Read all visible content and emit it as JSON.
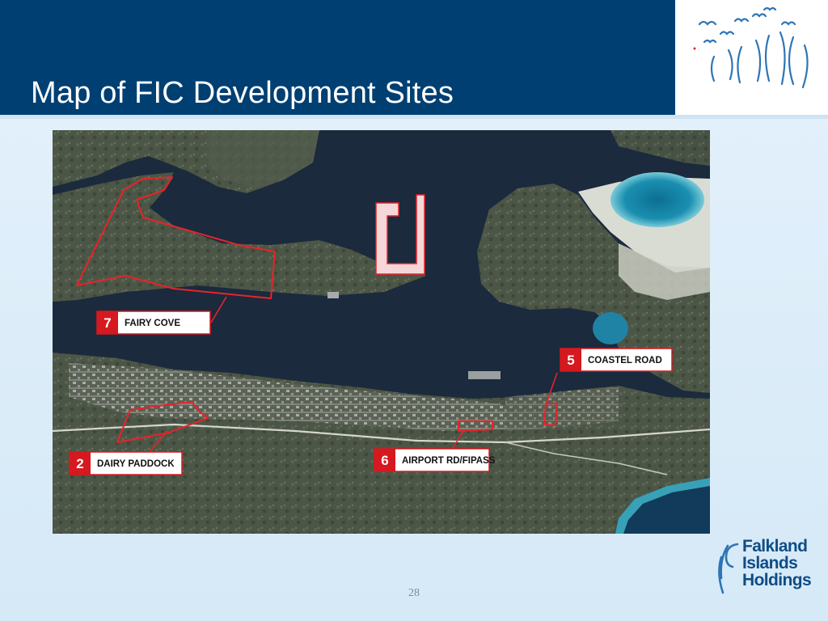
{
  "slide": {
    "title": "Map of FIC Development Sites",
    "page_number": "28"
  },
  "colors": {
    "header_band": "#003f72",
    "slide_background": "#dcedf9",
    "site_outline": "#e8232a",
    "label_number_box": "#d6181f",
    "logo_text": "#0e4d87"
  },
  "map": {
    "type": "aerial-photograph",
    "sites": [
      {
        "number": "7",
        "name": "FAIRY COVE"
      },
      {
        "number": "5",
        "name": "COASTEL ROAD"
      },
      {
        "number": "2",
        "name": "DAIRY PADDOCK"
      },
      {
        "number": "6",
        "name": "AIRPORT RD/FIPASS"
      }
    ]
  },
  "logos": {
    "top": {
      "icon": "birds-icon"
    },
    "bottom": {
      "icon": "swan-icon",
      "line1": "Falkland",
      "line2": "Islands",
      "line3": "Holdings"
    }
  }
}
